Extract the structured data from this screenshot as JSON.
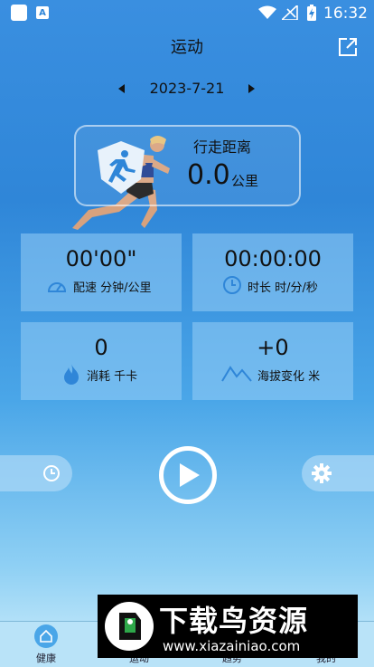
{
  "status": {
    "time": "16:32"
  },
  "header": {
    "title": "运动"
  },
  "date": {
    "value": "2023-7-21"
  },
  "distance": {
    "label": "行走距离",
    "value": "0.0",
    "unit": "公里"
  },
  "stats": [
    {
      "value": "00'00\"",
      "label": "配速 分钟/公里",
      "icon": "speedometer-icon"
    },
    {
      "value": "00:00:00",
      "label": "时长 时/分/秒",
      "icon": "clock-icon"
    },
    {
      "value": "0",
      "label": "消耗 千卡",
      "icon": "flame-icon"
    },
    {
      "value": "+0",
      "label": "海拔变化 米",
      "icon": "mountain-icon"
    }
  ],
  "nav": {
    "items": [
      {
        "label": "健康"
      },
      {
        "label": "运动"
      },
      {
        "label": "趋势"
      },
      {
        "label": "我的"
      }
    ]
  },
  "watermark": {
    "title": "下载鸟资源",
    "url": "www.xiazainiao.com"
  },
  "colors": {
    "accent": "#2f86d8",
    "icon_blue": "#2f86d8",
    "text": "#111111"
  }
}
